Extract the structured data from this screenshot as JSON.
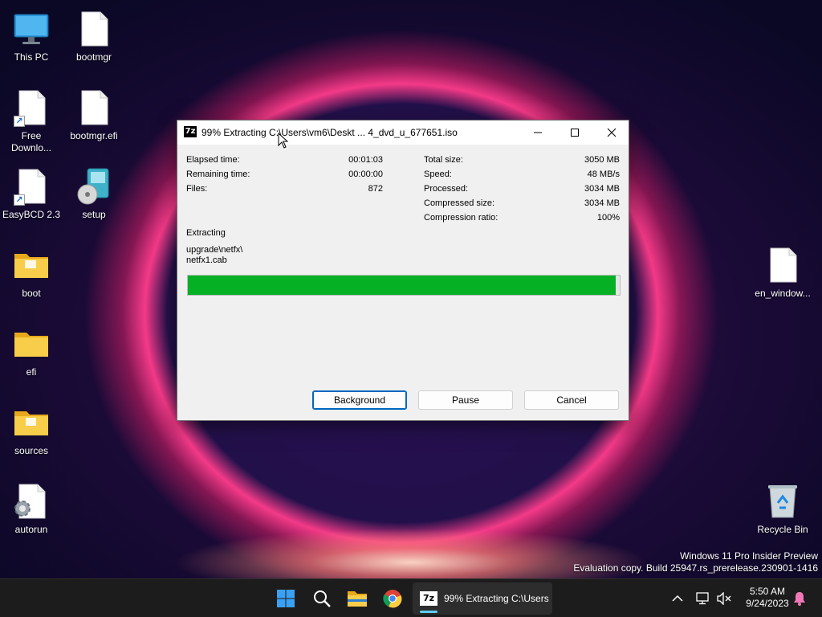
{
  "desktop": {
    "icons": [
      {
        "label": "This PC"
      },
      {
        "label": "bootmgr"
      },
      {
        "label": "Free Downlo..."
      },
      {
        "label": "bootmgr.efi"
      },
      {
        "label": "EasyBCD 2.3"
      },
      {
        "label": "setup"
      },
      {
        "label": "boot"
      },
      {
        "label": "efi"
      },
      {
        "label": "sources"
      },
      {
        "label": "autorun"
      },
      {
        "label": "en_window..."
      },
      {
        "label": "Recycle Bin"
      }
    ],
    "watermark_line1": "Windows 11 Pro Insider Preview",
    "watermark_line2": "Evaluation copy. Build 25947.rs_prerelease.230901-1416"
  },
  "dialog": {
    "title": "99% Extracting C:\\Users\\vm6\\Deskt ... 4_dvd_u_677651.iso",
    "left_stats": [
      {
        "label": "Elapsed time:",
        "value": "00:01:03"
      },
      {
        "label": "Remaining time:",
        "value": "00:00:00"
      },
      {
        "label": "Files:",
        "value": "872"
      }
    ],
    "right_stats": [
      {
        "label": "Total size:",
        "value": "3050 MB"
      },
      {
        "label": "Speed:",
        "value": "48 MB/s"
      },
      {
        "label": "Processed:",
        "value": "3034 MB"
      },
      {
        "label": "Compressed size:",
        "value": "3034 MB"
      },
      {
        "label": "Compression ratio:",
        "value": "100%"
      }
    ],
    "operation": "Extracting",
    "current_path": "upgrade\\netfx\\",
    "current_file": "netfx1.cab",
    "progress_fraction": 0.99,
    "progress_color": "#06b025",
    "buttons": {
      "background": "Background",
      "pause": "Pause",
      "cancel": "Cancel"
    }
  },
  "taskbar": {
    "app_label": "99% Extracting C:\\Users",
    "time": "5:50 AM",
    "date": "9/24/2023",
    "accent": "#60cdff"
  }
}
